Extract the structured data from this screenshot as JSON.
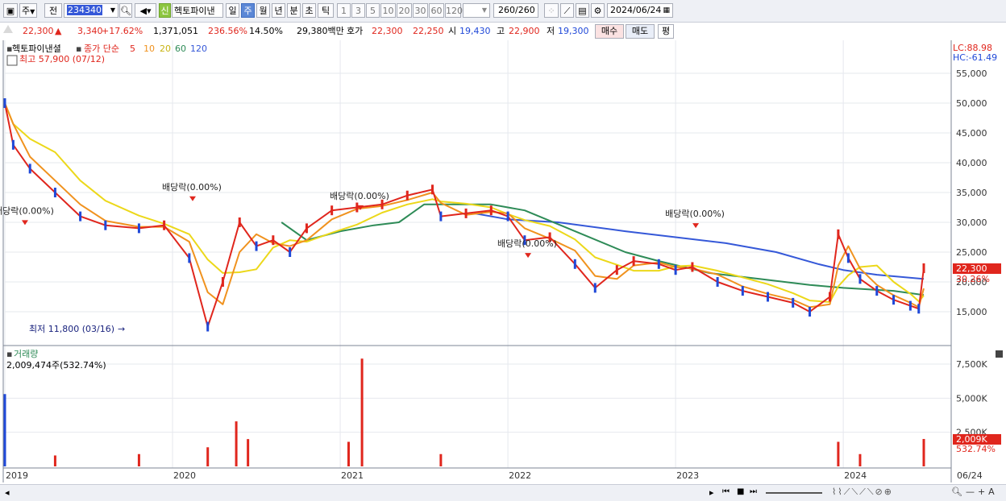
{
  "toolbar": {
    "period_select": "주",
    "prev_label": "전",
    "stock_code": "234340",
    "new_badge": "신",
    "stock_name": "헥토파이낸",
    "periods": [
      "일",
      "주",
      "월",
      "년",
      "분",
      "초",
      "틱"
    ],
    "active_period": "주",
    "intervals": [
      "1",
      "3",
      "5",
      "10",
      "20",
      "30",
      "60",
      "120"
    ],
    "count_display": "260",
    "count_total": "/260",
    "date": "2024/06/24"
  },
  "quote": {
    "price": "22,300",
    "arrow": "▲",
    "change": "3,340",
    "change_pct": "+17.62%",
    "volume": "1,371,051",
    "volume_ratio": "236.56%",
    "turnover": "14.50%",
    "amount": "29,380백만",
    "bid_label": "호가",
    "ask_price": "22,300",
    "bid_price": "22,250",
    "open_label": "시",
    "open": "19,430",
    "high_label": "고",
    "high": "22,900",
    "low_label": "저",
    "low": "19,300",
    "buy_label": "매수",
    "sell_label": "매도",
    "eval_label": "평"
  },
  "chart_data": {
    "type": "candlestick",
    "stock_name": "헥토파이낸셜",
    "legend_label": "종가 단순",
    "ma_periods": [
      "5",
      "10",
      "20",
      "60",
      "120"
    ],
    "ma_colors": [
      "#e0261d",
      "#f0921e",
      "#ecd81a",
      "#2e8b57",
      "#3558d8"
    ],
    "high_note": "최고 57,900 (07/12)",
    "low_note": "최저 11,800 (03/16)",
    "lc_label": "LC:88.98",
    "hc_label": "HC:-61.49",
    "last_price_label": "22,300",
    "last_price_pct": "30.26%",
    "price_ticks": [
      "15,000",
      "20,000",
      "25,000",
      "30,000",
      "35,000",
      "40,000",
      "45,000",
      "50,000",
      "55,000"
    ],
    "price_range": [
      11000,
      58000
    ],
    "x_labels": [
      "2019",
      "2020",
      "2021",
      "2022",
      "2023",
      "2024"
    ],
    "x_right_label": "06/24",
    "dividend_label": "배당락(0.00%)",
    "dividends": [
      {
        "date": "2019.12",
        "price": 29000
      },
      {
        "date": "2020.12",
        "price": 33000
      },
      {
        "date": "2021.12",
        "price": 31500
      },
      {
        "date": "2022.12",
        "price": 23500
      },
      {
        "date": "2023.12",
        "price": 28500
      }
    ],
    "price_points": [
      {
        "t": "2019.00",
        "v": 50000
      },
      {
        "t": "2019.05",
        "v": 43000
      },
      {
        "t": "2019.15",
        "v": 39000
      },
      {
        "t": "2019.30",
        "v": 35000
      },
      {
        "t": "2019.45",
        "v": 31000
      },
      {
        "t": "2019.60",
        "v": 29500
      },
      {
        "t": "2019.80",
        "v": 29000
      },
      {
        "t": "2019.95",
        "v": 29500
      },
      {
        "t": "2020.10",
        "v": 24000
      },
      {
        "t": "2020.21",
        "v": 12500
      },
      {
        "t": "2020.30",
        "v": 20000
      },
      {
        "t": "2020.40",
        "v": 30000
      },
      {
        "t": "2020.50",
        "v": 26000
      },
      {
        "t": "2020.60",
        "v": 27000
      },
      {
        "t": "2020.70",
        "v": 25000
      },
      {
        "t": "2020.80",
        "v": 29000
      },
      {
        "t": "2020.95",
        "v": 32000
      },
      {
        "t": "2021.10",
        "v": 32500
      },
      {
        "t": "2021.25",
        "v": 33000
      },
      {
        "t": "2021.40",
        "v": 34500
      },
      {
        "t": "2021.55",
        "v": 35500
      },
      {
        "t": "2021.60",
        "v": 31000
      },
      {
        "t": "2021.75",
        "v": 31500
      },
      {
        "t": "2021.90",
        "v": 32000
      },
      {
        "t": "2022.00",
        "v": 31000
      },
      {
        "t": "2022.10",
        "v": 27000
      },
      {
        "t": "2022.25",
        "v": 27500
      },
      {
        "t": "2022.40",
        "v": 23000
      },
      {
        "t": "2022.52",
        "v": 19000
      },
      {
        "t": "2022.65",
        "v": 22000
      },
      {
        "t": "2022.75",
        "v": 23500
      },
      {
        "t": "2022.90",
        "v": 23000
      },
      {
        "t": "2023.00",
        "v": 22000
      },
      {
        "t": "2023.10",
        "v": 22500
      },
      {
        "t": "2023.25",
        "v": 20000
      },
      {
        "t": "2023.40",
        "v": 18500
      },
      {
        "t": "2023.55",
        "v": 17500
      },
      {
        "t": "2023.70",
        "v": 16500
      },
      {
        "t": "2023.80",
        "v": 15000
      },
      {
        "t": "2023.92",
        "v": 17500
      },
      {
        "t": "2023.97",
        "v": 28000
      },
      {
        "t": "2024.03",
        "v": 24000
      },
      {
        "t": "2024.10",
        "v": 20500
      },
      {
        "t": "2024.20",
        "v": 18500
      },
      {
        "t": "2024.30",
        "v": 17000
      },
      {
        "t": "2024.40",
        "v": 16000
      },
      {
        "t": "2024.45",
        "v": 15500
      },
      {
        "t": "2024.48",
        "v": 22300
      }
    ],
    "ma60_points": [
      {
        "t": "2020.65",
        "v": 30000
      },
      {
        "t": "2020.80",
        "v": 27000
      },
      {
        "t": "2021.00",
        "v": 28500
      },
      {
        "t": "2021.20",
        "v": 29500
      },
      {
        "t": "2021.35",
        "v": 30000
      },
      {
        "t": "2021.50",
        "v": 33000
      },
      {
        "t": "2021.70",
        "v": 33000
      },
      {
        "t": "2021.90",
        "v": 33000
      },
      {
        "t": "2022.10",
        "v": 32000
      },
      {
        "t": "2022.40",
        "v": 28500
      },
      {
        "t": "2022.70",
        "v": 25000
      },
      {
        "t": "2022.90",
        "v": 23500
      },
      {
        "t": "2023.20",
        "v": 21500
      },
      {
        "t": "2023.50",
        "v": 20500
      },
      {
        "t": "2023.80",
        "v": 19500
      },
      {
        "t": "2024.00",
        "v": 19000
      },
      {
        "t": "2024.30",
        "v": 18500
      },
      {
        "t": "2024.48",
        "v": 17800
      }
    ],
    "ma120_points": [
      {
        "t": "2021.80",
        "v": 31500
      },
      {
        "t": "2022.00",
        "v": 30500
      },
      {
        "t": "2022.30",
        "v": 30000
      },
      {
        "t": "2022.70",
        "v": 28500
      },
      {
        "t": "2023.00",
        "v": 27500
      },
      {
        "t": "2023.30",
        "v": 26500
      },
      {
        "t": "2023.60",
        "v": 25000
      },
      {
        "t": "2023.85",
        "v": 23000
      },
      {
        "t": "2024.00",
        "v": 22000
      },
      {
        "t": "2024.20",
        "v": 21200
      },
      {
        "t": "2024.48",
        "v": 20500
      }
    ],
    "volume_title": "거래량",
    "volume_note": "2,009,474주(532.74%)",
    "volume_ticks": [
      "2,500K",
      "5,000K",
      "7,500K"
    ],
    "volume_last_label": "2,009K",
    "volume_last_pct": "532.74%",
    "volume_points": [
      {
        "t": "2019.00",
        "v": 5300
      },
      {
        "t": "2019.30",
        "v": 800
      },
      {
        "t": "2019.80",
        "v": 900
      },
      {
        "t": "2020.21",
        "v": 1400
      },
      {
        "t": "2020.38",
        "v": 3300
      },
      {
        "t": "2020.45",
        "v": 2000
      },
      {
        "t": "2021.05",
        "v": 1800
      },
      {
        "t": "2021.13",
        "v": 7900
      },
      {
        "t": "2021.60",
        "v": 900
      },
      {
        "t": "2023.97",
        "v": 1800
      },
      {
        "t": "2024.10",
        "v": 900
      },
      {
        "t": "2024.48",
        "v": 2009
      }
    ]
  },
  "bottom": {
    "icons": [
      "scroll-left-icon",
      "scroll-right-icon",
      "first-icon",
      "prev-icon",
      "stop-icon",
      "next-icon"
    ]
  }
}
